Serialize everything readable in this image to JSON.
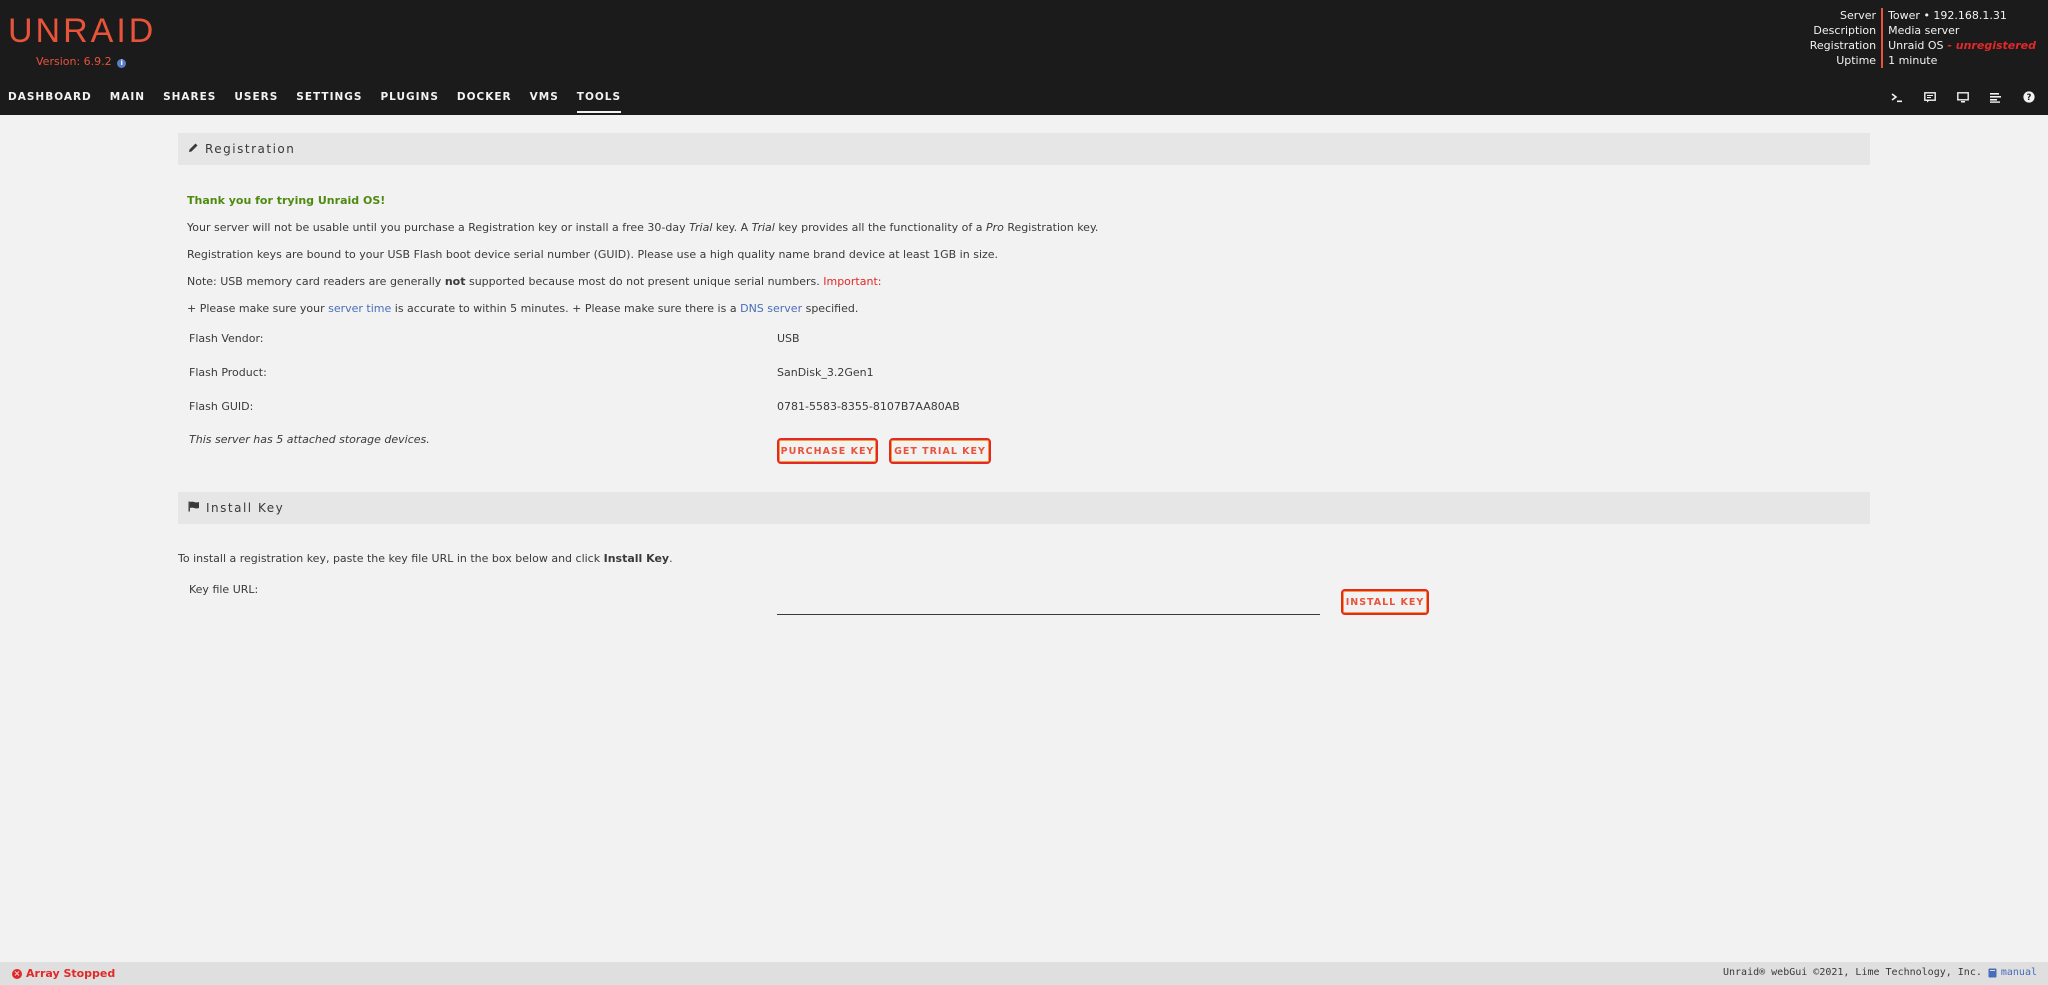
{
  "header": {
    "logo": "UNRAID",
    "version": "Version: 6.9.2",
    "server_info": {
      "labels": [
        "Server",
        "Description",
        "Registration",
        "Uptime"
      ],
      "server": "Tower • 192.168.1.31",
      "description": "Media server",
      "registration_prefix": "Unraid OS",
      "registration_status": " - unregistered",
      "uptime": "1 minute"
    }
  },
  "nav": {
    "items": [
      "DASHBOARD",
      "MAIN",
      "SHARES",
      "USERS",
      "SETTINGS",
      "PLUGINS",
      "DOCKER",
      "VMS",
      "TOOLS"
    ],
    "active": "TOOLS",
    "icons": [
      "terminal-icon",
      "notifications-icon",
      "monitor-icon",
      "log-icon",
      "help-icon"
    ]
  },
  "registration": {
    "title": "Registration",
    "thanks": "Thank you for trying Unraid OS!",
    "line1_a": "Your server will not be usable until you purchase a Registration key or install a free 30-day ",
    "line1_trial": "Trial",
    "line1_b": " key. A ",
    "line1_trial2": "Trial",
    "line1_c": " key provides all the functionality of a ",
    "line1_pro": "Pro",
    "line1_d": " Registration key.",
    "line2": "Registration keys are bound to your USB Flash boot device serial number (GUID). Please use a high quality name brand device at least 1GB in size.",
    "line3_a": "Note: USB memory card readers are generally ",
    "line3_not": "not",
    "line3_b": " supported because most do not present unique serial numbers. ",
    "line3_important": "Important:",
    "line4_a": "+ Please make sure your ",
    "line4_server_time": "server time",
    "line4_b": " is accurate to within 5 minutes. + Please make sure there is a ",
    "line4_dns": "DNS server",
    "line4_c": " specified.",
    "flash_vendor_label": "Flash Vendor:",
    "flash_vendor": "USB",
    "flash_product_label": "Flash Product:",
    "flash_product": "SanDisk_3.2Gen1",
    "flash_guid_label": "Flash GUID:",
    "flash_guid": "0781-5583-8355-8107B7AA80AB",
    "attached_devices": "This server has 5 attached storage devices.",
    "purchase_key": "PURCHASE KEY",
    "get_trial_key": "GET TRIAL KEY"
  },
  "install_key": {
    "title": "Install Key",
    "instructions_a": "To install a registration key, paste the key file URL in the box below and click ",
    "instructions_bold": "Install Key",
    "instructions_b": ".",
    "key_file_url_label": "Key file URL:",
    "key_file_url_value": "",
    "install_button": "INSTALL KEY"
  },
  "footer": {
    "array_status": "Array Stopped",
    "copyright": "Unraid® webGui ©2021, Lime Technology, Inc.",
    "manual": "manual"
  },
  "colors": {
    "brand": "#e8533a",
    "header_bg": "#1c1b1b",
    "error": "#e22828",
    "success": "#4f8a10",
    "link": "#486dba"
  }
}
